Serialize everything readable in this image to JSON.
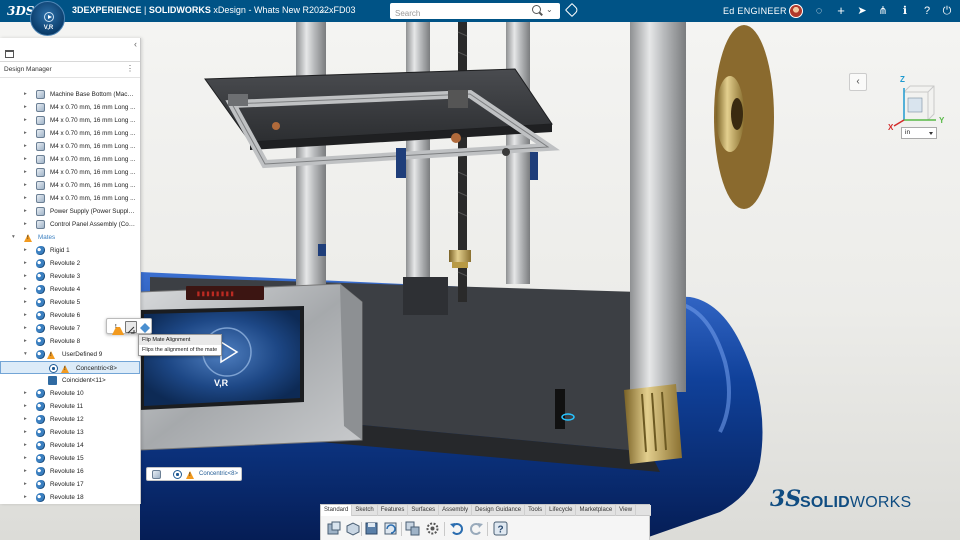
{
  "topbar": {
    "logo": "3DS",
    "compass_label": "V,R",
    "brand": "3DEXPERIENCE",
    "product": "SOLIDWORKS",
    "app": "xDesign",
    "doc": "Whats New R2022xFD03",
    "search_placeholder": "Search",
    "user": "Ed ENGINEER",
    "icons": [
      "tag-icon",
      "compass-icon",
      "add-icon",
      "share-icon",
      "apps-icon",
      "help-icon",
      "power-icon"
    ]
  },
  "design_manager": {
    "title": "Design Manager",
    "rows": [
      {
        "label": "Machine Base Bottom (Machi...",
        "icon": "part",
        "level": 1
      },
      {
        "label": "M4 x 0.70 mm, 16 mm Long ...",
        "icon": "part",
        "level": 1
      },
      {
        "label": "M4 x 0.70 mm, 16 mm Long ...",
        "icon": "part",
        "level": 1
      },
      {
        "label": "M4 x 0.70 mm, 16 mm Long ...",
        "icon": "part",
        "level": 1
      },
      {
        "label": "M4 x 0.70 mm, 16 mm Long ...",
        "icon": "part",
        "level": 1
      },
      {
        "label": "M4 x 0.70 mm, 16 mm Long ...",
        "icon": "part",
        "level": 1
      },
      {
        "label": "M4 x 0.70 mm, 16 mm Long ...",
        "icon": "part",
        "level": 1
      },
      {
        "label": "M4 x 0.70 mm, 16 mm Long ...",
        "icon": "part",
        "level": 1
      },
      {
        "label": "M4 x 0.70 mm, 16 mm Long ...",
        "icon": "part",
        "level": 1
      },
      {
        "label": "Power Supply (Power Supply 1)",
        "icon": "part",
        "level": 1
      },
      {
        "label": "Control Panel Assembly (Con...",
        "icon": "part",
        "level": 1
      },
      {
        "label": "Mates",
        "icon": "warn",
        "level": 0,
        "expanded": true,
        "accent": true
      },
      {
        "label": "Rigid 1",
        "icon": "mate",
        "level": 2
      },
      {
        "label": "Revolute 2",
        "icon": "mate",
        "level": 2
      },
      {
        "label": "Revolute 3",
        "icon": "mate",
        "level": 1
      },
      {
        "label": "Revolute 4",
        "icon": "mate",
        "level": 2
      },
      {
        "label": "Revolute 5",
        "icon": "mate",
        "level": 1
      },
      {
        "label": "Revolute 6",
        "icon": "mate",
        "level": 1
      },
      {
        "label": "Revolute 7",
        "icon": "mate",
        "level": 1
      },
      {
        "label": "Revolute 8",
        "icon": "mate",
        "level": 1
      },
      {
        "label": "UserDefined 9",
        "icon": "warn-mate",
        "level": 1,
        "expanded": true
      },
      {
        "label": "Concentric<8>",
        "icon": "concentric",
        "level": 3,
        "selected": true
      },
      {
        "label": "Coincident<11>",
        "icon": "coincident",
        "level": 3
      },
      {
        "label": "Revolute 10",
        "icon": "mate",
        "level": 1
      },
      {
        "label": "Revolute 11",
        "icon": "mate",
        "level": 1
      },
      {
        "label": "Revolute 12",
        "icon": "mate",
        "level": 1
      },
      {
        "label": "Revolute 13",
        "icon": "mate",
        "level": 1
      },
      {
        "label": "Revolute 14",
        "icon": "mate",
        "level": 1
      },
      {
        "label": "Revolute 15",
        "icon": "mate",
        "level": 1
      },
      {
        "label": "Revolute 16",
        "icon": "mate",
        "level": 1
      },
      {
        "label": "Revolute 17",
        "icon": "mate",
        "level": 1
      },
      {
        "label": "Revolute 18",
        "icon": "mate",
        "level": 1
      }
    ]
  },
  "tooltip": {
    "title": "Flip Mate Alignment",
    "desc": "Flips the alignment of the mate"
  },
  "chip": {
    "label": "Concentric<8>"
  },
  "navcube": {
    "x": "X",
    "y": "Y",
    "z": "Z"
  },
  "units": {
    "value": "in"
  },
  "panel_label": "V,R",
  "watermark": {
    "mark": "3S",
    "bold": "SOLID",
    "rest": "WORKS"
  },
  "action_bar": {
    "tabs": [
      "Standard",
      "Sketch",
      "Features",
      "Surfaces",
      "Assembly",
      "Design Guidance",
      "Tools",
      "Lifecycle",
      "Marketplace",
      "View"
    ],
    "active": "Standard",
    "tools": [
      "new-component-icon",
      "insert-component-icon",
      "save-icon",
      "rebuild-icon",
      "copy-icon",
      "settings-icon",
      "undo-icon",
      "redo-icon",
      "help-icon"
    ]
  },
  "colors": {
    "topbar": "#005386",
    "accent": "#3a7fc0",
    "warning": "#f29a1f",
    "machine_blue": "#0d3a8a"
  }
}
